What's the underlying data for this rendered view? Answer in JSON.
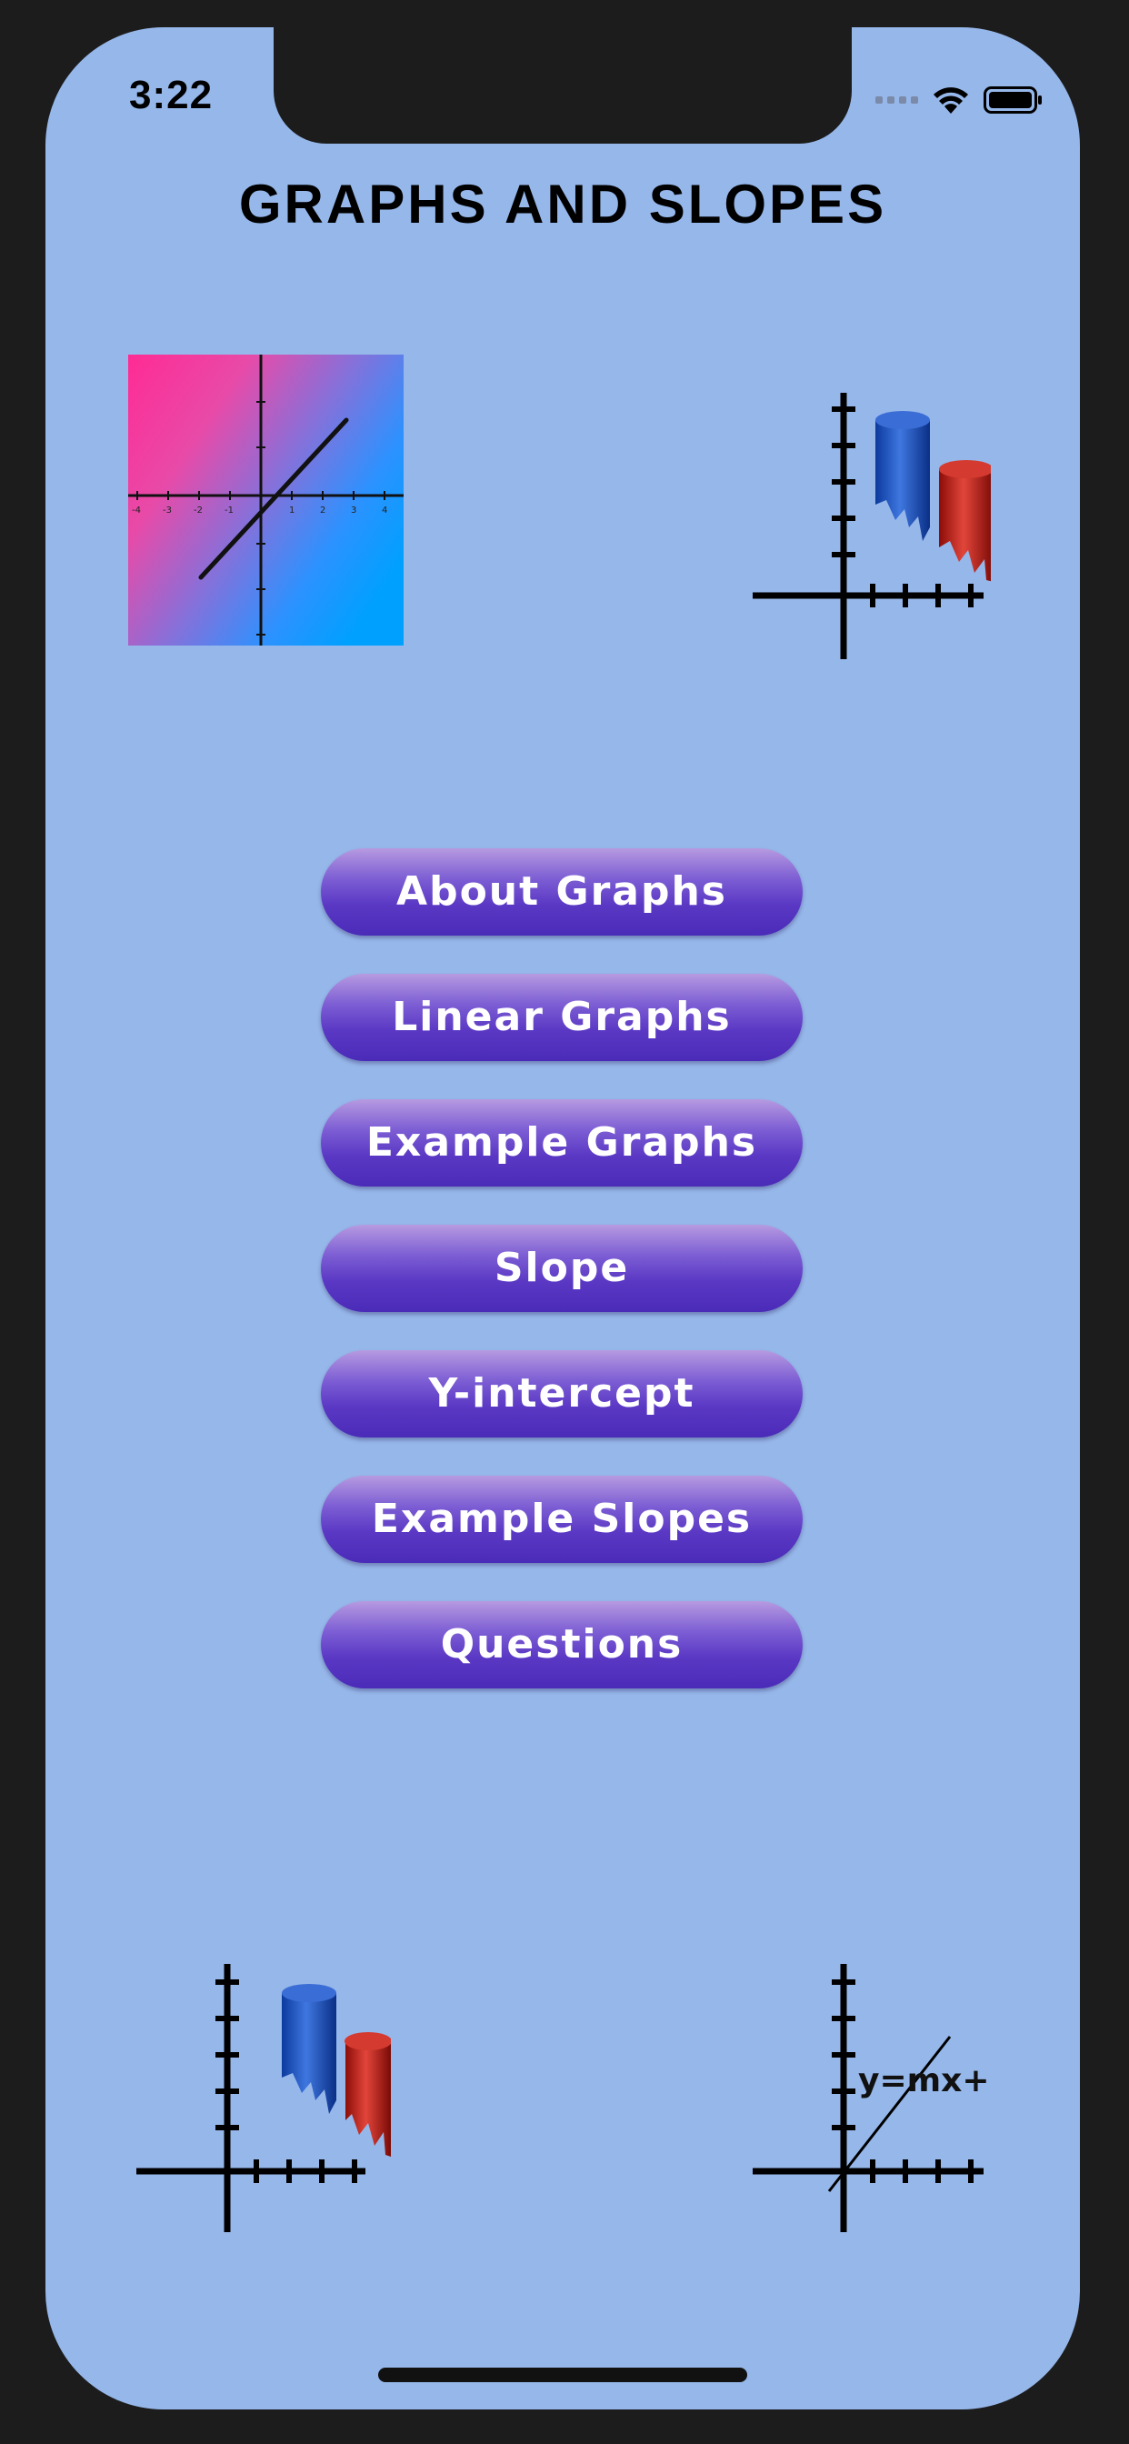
{
  "status_bar": {
    "time": "3:22"
  },
  "header": {
    "title": "GRAPHS AND SLOPES"
  },
  "menu": {
    "buttons": [
      {
        "label": "About Graphs"
      },
      {
        "label": "Linear Graphs"
      },
      {
        "label": "Example Graphs"
      },
      {
        "label": "Slope"
      },
      {
        "label": "Y-intercept"
      },
      {
        "label": "Example Slopes"
      },
      {
        "label": "Questions"
      }
    ]
  },
  "images": {
    "linear_graph_ticks": [
      "-4",
      "-3",
      "-2",
      "-1",
      "1",
      "2",
      "3",
      "4"
    ],
    "equation_label": "y=mx+c"
  },
  "colors": {
    "background": "#96b7ea",
    "button_top": "#b69ae0",
    "button_bottom": "#4a2bb8",
    "frame": "#1c1c1c"
  },
  "icons": [
    "wifi-icon",
    "battery-icon",
    "cellular-signal-icon"
  ]
}
